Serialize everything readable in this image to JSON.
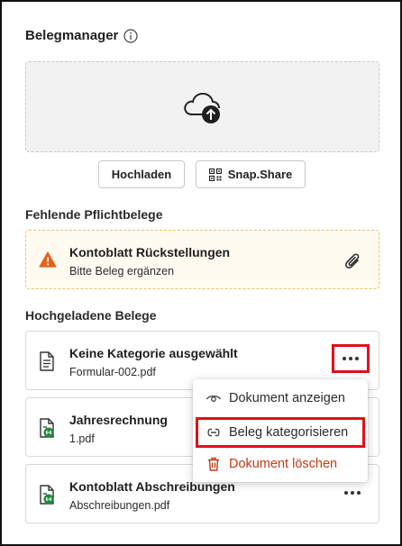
{
  "panel": {
    "title": "Belegmanager",
    "upload_button": "Hochladen",
    "snapshare_button": "Snap.Share"
  },
  "missing": {
    "section_title": "Fehlende Pflichtbelege",
    "items": [
      {
        "title": "Kontoblatt Rückstellungen",
        "subtitle": "Bitte Beleg ergänzen"
      }
    ]
  },
  "uploaded": {
    "section_title": "Hochgeladene Belege",
    "items": [
      {
        "title": "Keine Kategorie ausgewählt",
        "filename": "Formular-002.pdf",
        "icon": "document-icon"
      },
      {
        "title": "Jahresrechnung",
        "filename": "1.pdf",
        "icon": "document-linked-icon"
      },
      {
        "title": "Kontoblatt Abschreibungen",
        "filename": "Abschreibungen.pdf",
        "icon": "document-linked-icon"
      }
    ]
  },
  "context_menu": {
    "items": [
      {
        "label": "Dokument anzeigen",
        "icon": "eye-icon"
      },
      {
        "label": "Beleg kategorisieren",
        "icon": "link-icon"
      },
      {
        "label": "Dokument löschen",
        "icon": "trash-icon"
      }
    ]
  },
  "colors": {
    "warning": "#e8611a",
    "link_badge": "#1e8c3a",
    "danger": "#c43a12",
    "highlight": "#e0101a"
  }
}
